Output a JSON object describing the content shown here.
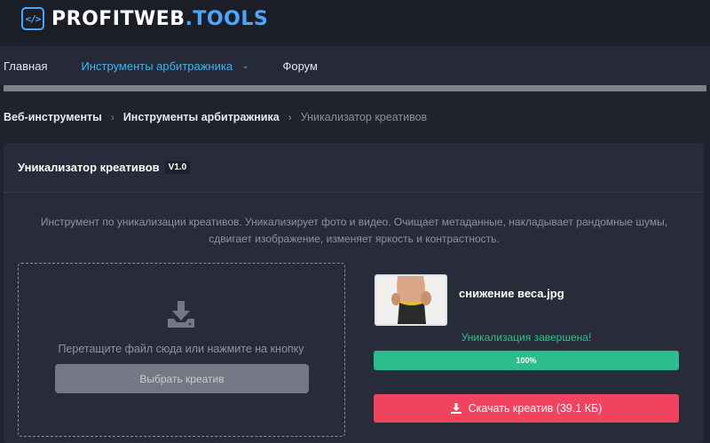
{
  "brand": {
    "name_main": "PROFITWEB",
    "name_accent": ".TOOLS"
  },
  "nav": {
    "items": [
      {
        "label": "Главная"
      },
      {
        "label": "Инструменты арбитражника"
      },
      {
        "label": "Форум"
      }
    ]
  },
  "breadcrumb": [
    "Веб-инструменты",
    "Инструменты арбитражника",
    "Уникализатор креативов"
  ],
  "tool": {
    "title": "Уникализатор креативов",
    "version": "V1.0",
    "description_line1": "Инструмент по уникализации креативов. Уникализирует фото и видео. Очищает метаданные, накладывает рандомные шумы,",
    "description_line2": "сдвигает изображение, изменяет яркость и контрастность."
  },
  "dropzone": {
    "hint": "Перетащите файл сюда или нажмите на кнопку",
    "button_label": "Выбрать креатив"
  },
  "result": {
    "filename": "снижение веса.jpg",
    "status": "Уникализация завершена!",
    "progress_label": "100%",
    "progress": 1.0,
    "download_label": "Скачать креатив (39.1 КБ)"
  },
  "colors": {
    "accent_blue": "#3fb4f0",
    "success_green": "#2bbd8c",
    "download_red": "#f0435e"
  }
}
